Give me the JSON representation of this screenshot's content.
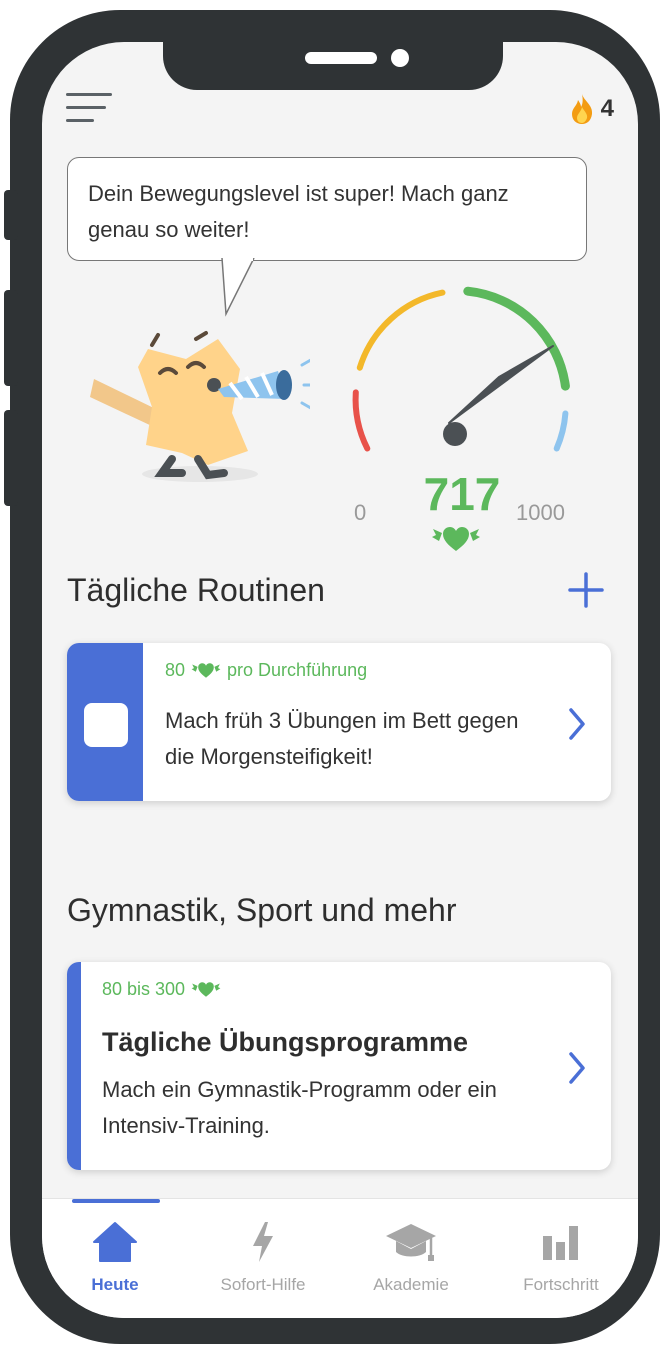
{
  "header": {
    "menu_icon": "hamburger-menu-icon",
    "streak_icon": "flame-icon",
    "streak_count": "4"
  },
  "speech_bubble": {
    "text": "Dein Bewegungslevel ist super! Mach ganz genau so weiter!"
  },
  "score_gauge": {
    "score": "717",
    "min_label": "0",
    "max_label": "1000",
    "value": 717,
    "min": 0,
    "max": 1000,
    "unit_icon": "winged-heart-icon",
    "colors": {
      "low": "#e8524a",
      "mid": "#f3b82a",
      "high": "#5cb85c",
      "top": "#8ec4ee",
      "needle": "#4b5054"
    }
  },
  "daily_routines": {
    "title": "Tägliche Routinen",
    "add_icon": "plus-icon",
    "items": [
      {
        "points": "80",
        "points_suffix": "pro Durchführung",
        "text": "Mach früh 3 Übungen im Bett gegen die Morgensteifigkeit!",
        "completed": false
      }
    ]
  },
  "gymnastics": {
    "title": "Gymnastik, Sport und mehr",
    "items": [
      {
        "points": "80 bis 300",
        "title": "Tägliche Übungsprogramme",
        "text": "Mach ein Gymnastik-Programm oder ein Intensiv-Training."
      }
    ]
  },
  "tabbar": {
    "active": "Heute",
    "tabs": [
      {
        "label": "Heute",
        "icon": "home-icon"
      },
      {
        "label": "Sofort-Hilfe",
        "icon": "lightning-icon"
      },
      {
        "label": "Akademie",
        "icon": "graduation-cap-icon"
      },
      {
        "label": "Fortschritt",
        "icon": "bar-chart-icon"
      }
    ]
  },
  "theme": {
    "accent": "#4a6fd6",
    "points_green": "#5cb85c",
    "background": "#f4f4f4"
  }
}
